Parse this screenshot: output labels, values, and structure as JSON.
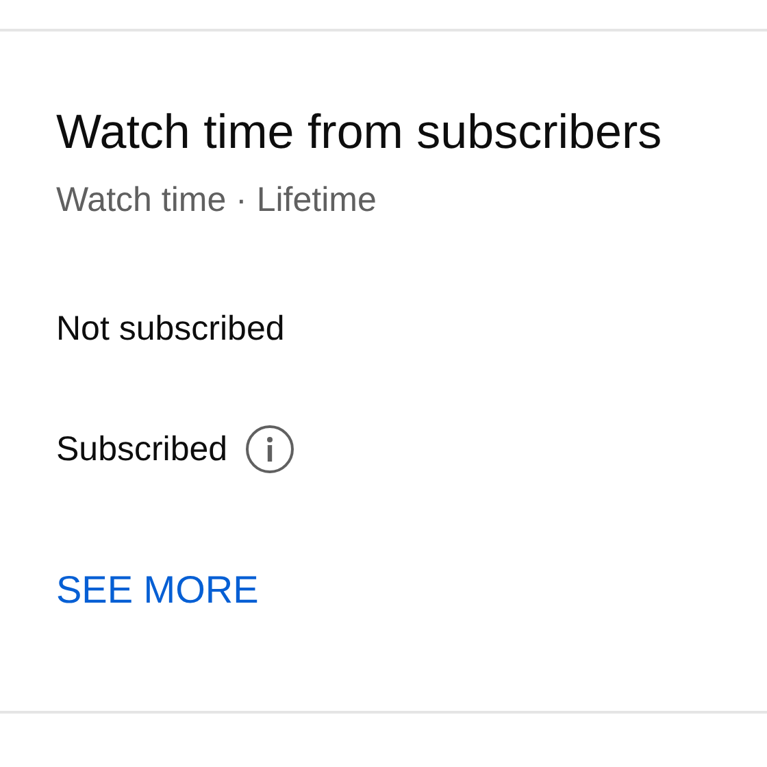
{
  "card": {
    "title": "Watch time from subscribers",
    "subtitle": "Watch time · Lifetime",
    "rows": [
      {
        "label": "Not subscribed",
        "info": false
      },
      {
        "label": "Subscribed",
        "info": true
      }
    ],
    "link": "SEE MORE"
  }
}
